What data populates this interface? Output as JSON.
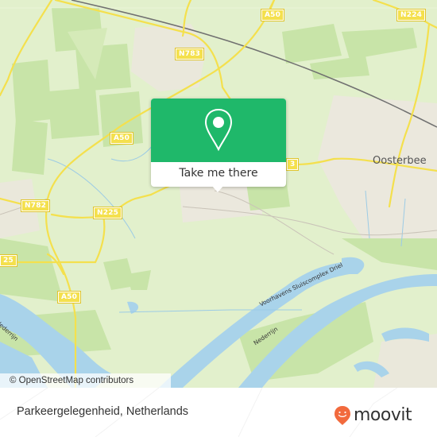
{
  "map": {
    "attribution": "© OpenStreetMap contributors",
    "colors": {
      "land": "#e2f0cc",
      "forest": "#c8e4a8",
      "urban": "#ece6df",
      "water": "#a9d3ea",
      "road": "#f4e04d",
      "rail": "#707070",
      "accent": "#1fb86a"
    },
    "road_shields": [
      {
        "id": "n783",
        "label": "N783"
      },
      {
        "id": "a50-top",
        "label": "A50"
      },
      {
        "id": "n224",
        "label": "N224"
      },
      {
        "id": "a50-mid",
        "label": "A50"
      },
      {
        "id": "n782",
        "label": "N782"
      },
      {
        "id": "n225",
        "label": "N225"
      },
      {
        "id": "n225-left",
        "label": "25"
      },
      {
        "id": "a50-bottom",
        "label": "A50"
      },
      {
        "id": "partial-right",
        "label": "3"
      }
    ],
    "place_labels": [
      {
        "id": "oosterbeek",
        "label": "Oosterbee"
      }
    ],
    "water_labels": [
      {
        "id": "voorhavens",
        "label": "Voorhavens Sluiscomplex Driel"
      },
      {
        "id": "nederrijn-right",
        "label": "Nederrijn"
      },
      {
        "id": "nederrijn-left",
        "label": "Nederrijn"
      }
    ]
  },
  "popup": {
    "icon": "map-pin-icon",
    "button_label": "Take me there"
  },
  "footer": {
    "title": "Parkeergelegenheid, Netherlands",
    "brand": "moovit",
    "brand_color": "#f26a3d"
  }
}
